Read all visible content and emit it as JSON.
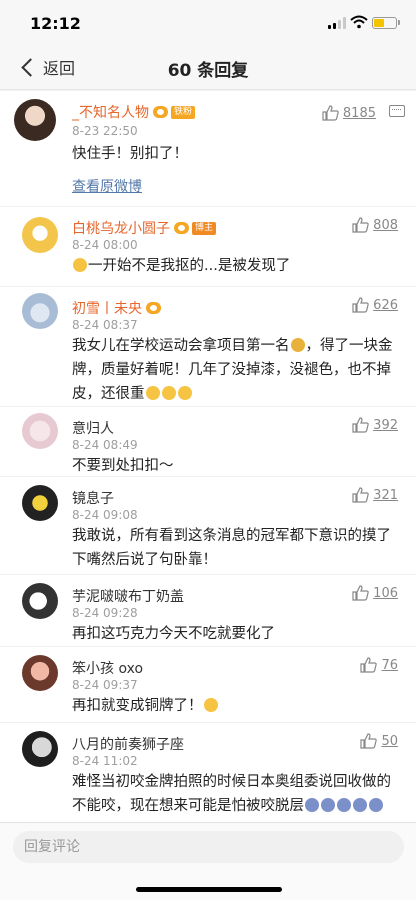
{
  "status": {
    "time": "12:12"
  },
  "nav": {
    "back_label": "返回",
    "title": "60 条回复"
  },
  "original": {
    "username": "_不知名人物",
    "badge": "铁粉",
    "time": "8-23 22:50",
    "text": "快住手！别扣了！",
    "likes": "8185",
    "view_original": "查看原微博"
  },
  "comments": [
    {
      "username": "白桃乌龙小圆子",
      "badge": "博主",
      "time": "8-24 08:00",
      "text": "一开始不是我抠的...是被发现了",
      "likes": "808"
    },
    {
      "username": "初雪丨未央",
      "time": "8-24 08:37",
      "text_1": "我女儿在学校运动会拿项目第一名",
      "text_2": "，得了一块金牌，质量好着呢！几年了没掉漆，没褪色，也不掉皮，还很重",
      "likes": "626"
    },
    {
      "username": "意归人",
      "time": "8-24 08:49",
      "text": "不要到处扣扣～",
      "likes": "392"
    },
    {
      "username": "镜息子",
      "time": "8-24 09:08",
      "text": "我敢说，所有看到这条消息的冠军都下意识的摸了下嘴然后说了句卧靠！",
      "likes": "321"
    },
    {
      "username": "芋泥啵啵布丁奶盖",
      "time": "8-24 09:28",
      "text": "再扣这巧克力今天不吃就要化了",
      "likes": "106"
    },
    {
      "username": "笨小孩 oxo",
      "time": "8-24 09:37",
      "text": "再扣就变成铜牌了！",
      "likes": "76"
    },
    {
      "username": "八月的前奏狮子座",
      "time": "8-24 11:02",
      "text": "难怪当初咬金牌拍照的时候日本奥组委说回收做的不能咬，现在想来可能是怕被咬脱层",
      "likes": "50"
    }
  ],
  "reply": {
    "placeholder": "回复评论"
  },
  "colors": {
    "username": "#e6662b",
    "link": "#5379a8",
    "vip": "#f5a623"
  }
}
